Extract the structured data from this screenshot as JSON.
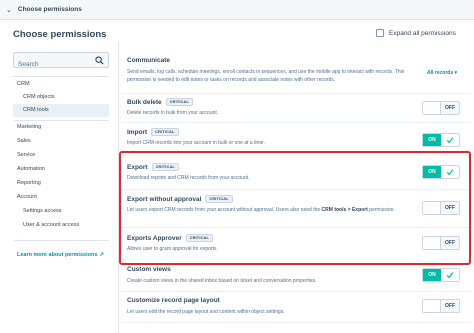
{
  "header": {
    "title": "Choose permissions"
  },
  "page": {
    "heading": "Choose permissions",
    "expand_label": "Expand all permissions"
  },
  "search": {
    "placeholder": "Search"
  },
  "sidebar": {
    "items": [
      {
        "label": "CRM",
        "indent": false,
        "active": false
      },
      {
        "label": "CRM objects",
        "indent": true,
        "active": false
      },
      {
        "label": "CRM tools",
        "indent": true,
        "active": true
      },
      {
        "label": "Marketing",
        "indent": false,
        "active": false
      },
      {
        "label": "Sales",
        "indent": false,
        "active": false
      },
      {
        "label": "Service",
        "indent": false,
        "active": false
      },
      {
        "label": "Automation",
        "indent": false,
        "active": false
      },
      {
        "label": "Reporting",
        "indent": false,
        "active": false
      },
      {
        "label": "Account",
        "indent": false,
        "active": false
      },
      {
        "label": "Settings access",
        "indent": true,
        "active": false
      },
      {
        "label": "User & account access",
        "indent": true,
        "active": false
      }
    ],
    "learn_more": "Learn more about permissions"
  },
  "permissions": {
    "communicate": {
      "name": "Communicate",
      "desc": "Send emails, log calls, schedule meetings, enroll contacts in sequences, and use the mobile app to interact with records. This permission is needed to edit notes or tasks on records and associate notes with other records.",
      "dropdown": "All records"
    },
    "bulk_delete": {
      "name": "Bulk delete",
      "badge": "CRITICAL",
      "desc": "Delete records in bulk from your account.",
      "toggle": "OFF",
      "state": false
    },
    "import": {
      "name": "Import",
      "badge": "CRITICAL",
      "desc": "Import CRM records into your account in bulk or one at a time.",
      "toggle": "ON",
      "state": true
    },
    "export": {
      "name": "Export",
      "badge": "CRITICAL",
      "desc": "Download reports and CRM records from your account.",
      "toggle": "ON",
      "state": true
    },
    "export_without_approval": {
      "name": "Export without approval",
      "badge": "CRITICAL",
      "desc_pre": "Let users export CRM records from your account without approval. Users also need the ",
      "desc_bold": "CRM tools > Export",
      "desc_post": " permission.",
      "toggle": "OFF",
      "state": false
    },
    "exports_approver": {
      "name": "Exports Approver",
      "badge": "CRITICAL",
      "desc": "Allows user to grant approval for exports",
      "toggle": "OFF",
      "state": false
    },
    "custom_views": {
      "name": "Custom views",
      "desc": "Create custom views in the shared inbox based on ticket and conversation properties.",
      "toggle": "ON",
      "state": true
    },
    "customize_layout": {
      "name": "Customize record page layout",
      "desc": "Let users edit the record page layout and content within object settings.",
      "toggle": "OFF",
      "state": false
    }
  },
  "colors": {
    "accent": "#00bda5",
    "link": "#0091ae",
    "highlight": "#e0272a",
    "text": "#33475b"
  },
  "icons": [
    "chevron-down-icon",
    "search-icon",
    "external-link-icon",
    "check-icon",
    "chevron-down-small-icon"
  ]
}
